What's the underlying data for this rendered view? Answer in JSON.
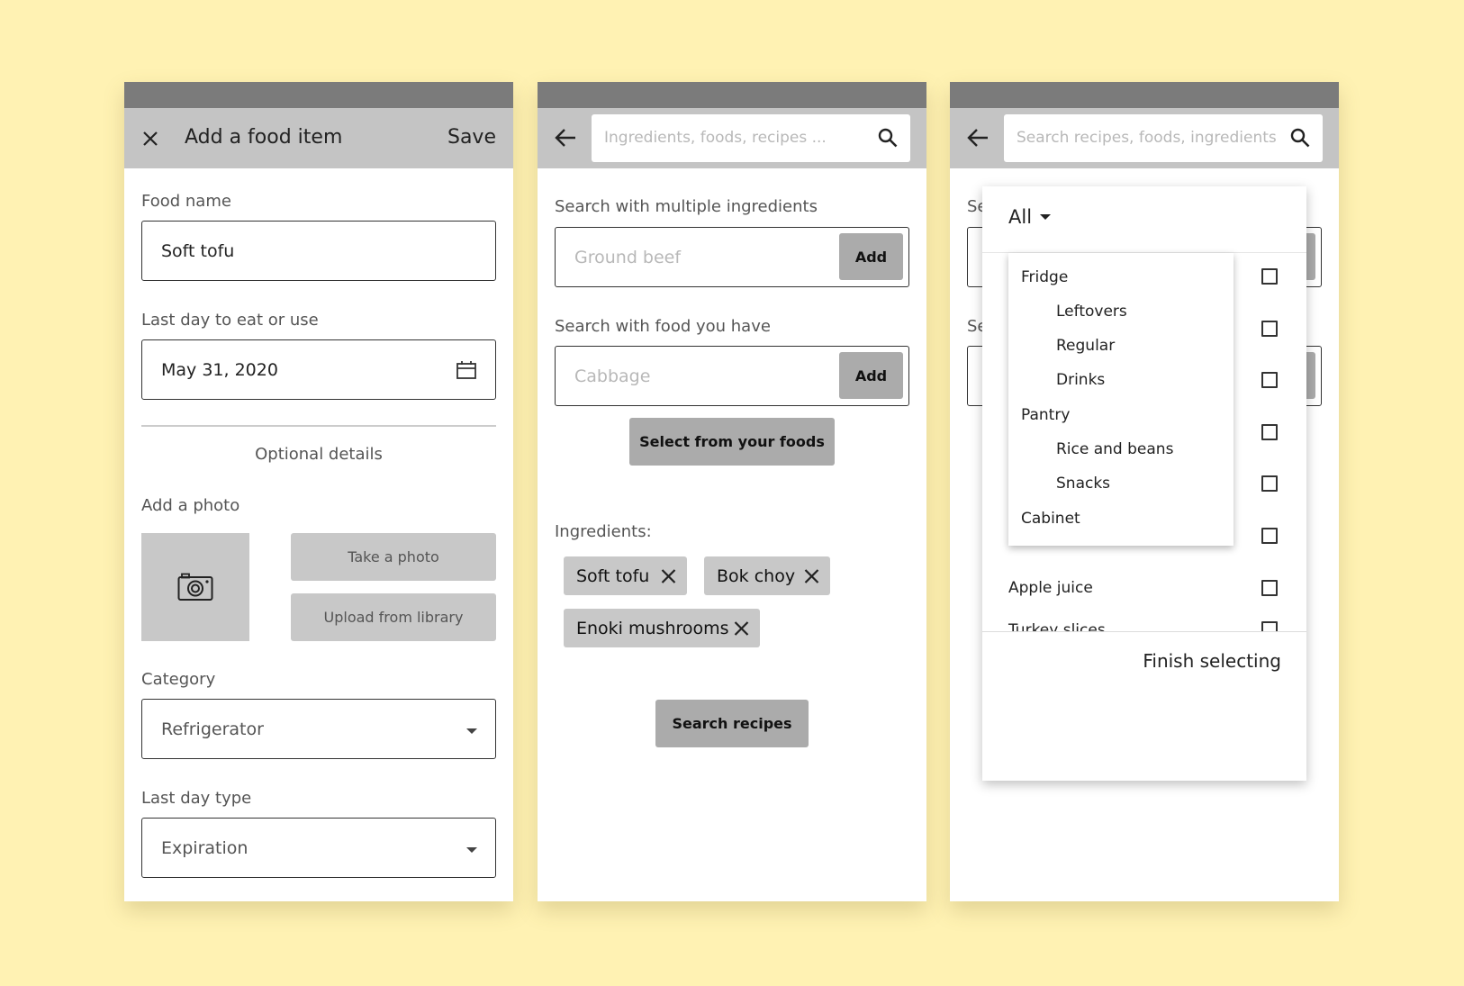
{
  "colors": {
    "background": "#fff2b3",
    "appbar": "#c4c4c4",
    "statusbar": "#7b7b7b",
    "button": "#ababab"
  },
  "screen1": {
    "title": "Add a food item",
    "save_label": "Save",
    "food_name_label": "Food name",
    "food_name_value": "Soft tofu",
    "last_day_label": "Last day to eat or use",
    "last_day_value": "May 31, 2020",
    "optional_details": "Optional details",
    "add_photo_label": "Add a photo",
    "take_photo": "Take a photo",
    "upload_library": "Upload from library",
    "category_label": "Category",
    "category_value": "Refrigerator",
    "last_day_type_label": "Last day type",
    "last_day_type_value": "Expiration"
  },
  "screen2": {
    "search_placeholder": "Ingredients, foods, recipes ...",
    "multi_label": "Search with multiple ingredients",
    "multi_placeholder": "Ground beef",
    "add_label": "Add",
    "have_label": "Search with food you have",
    "have_placeholder": "Cabbage",
    "select_foods": "Select from your foods",
    "ingredients_label": "Ingredients:",
    "chips": [
      "Soft tofu",
      "Bok choy",
      "Enoki mushrooms"
    ],
    "search_recipes": "Search recipes"
  },
  "screen3": {
    "search_placeholder": "Search recipes, foods, ingredients",
    "bg_label_1": "Se",
    "bg_label_2": "Se",
    "filter_value": "All",
    "menu": [
      "Fridge",
      "Leftovers",
      "Regular",
      "Drinks",
      "Pantry",
      "Rice and beans",
      "Snacks",
      "Cabinet"
    ],
    "list_items": [
      "Apple juice",
      "Turkey slices"
    ],
    "finish": "Finish selecting"
  }
}
